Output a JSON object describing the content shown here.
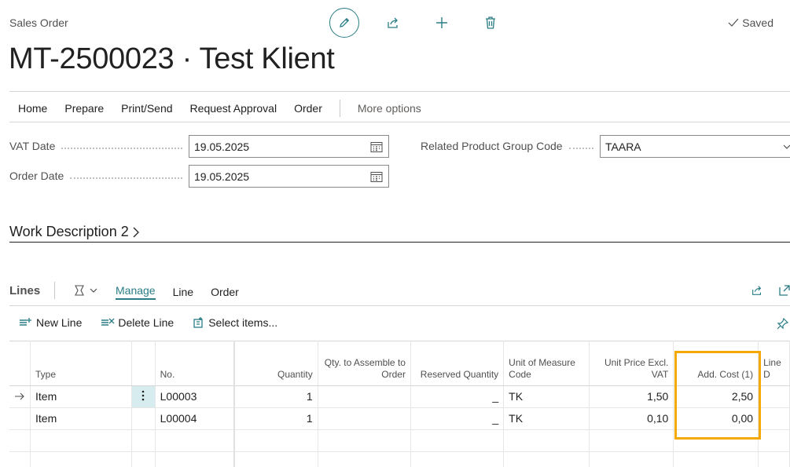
{
  "header": {
    "caption": "Sales Order",
    "title": "MT-2500023 · Test Klient",
    "saved_label": "Saved",
    "icons": [
      "edit-icon",
      "share-icon",
      "add-icon",
      "delete-icon"
    ]
  },
  "menu": {
    "items": [
      "Home",
      "Prepare",
      "Print/Send",
      "Request Approval",
      "Order"
    ],
    "more": "More options"
  },
  "fields": {
    "vat_date": {
      "label": "VAT Date",
      "value": "19.05.2025"
    },
    "order_date": {
      "label": "Order Date",
      "value": "19.05.2025"
    },
    "related_product_group": {
      "label": "Related Product Group Code",
      "value": "TAARA"
    }
  },
  "work_description": {
    "title": "Work Description 2"
  },
  "lines": {
    "title": "Lines",
    "tabs": [
      "Manage",
      "Line",
      "Order"
    ],
    "active_tab": "Manage",
    "actions": {
      "new_line": "New Line",
      "delete_line": "Delete Line",
      "select_items": "Select items..."
    },
    "columns": {
      "type": "Type",
      "no": "No.",
      "quantity": "Quantity",
      "qty_assemble": "Qty. to Assemble to Order",
      "reserved": "Reserved Quantity",
      "uom": "Unit of Measure Code",
      "unit_price": "Unit Price Excl. VAT",
      "add_cost": "Add. Cost (1)",
      "line_d": "Line D"
    },
    "rows": [
      {
        "type": "Item",
        "no": "L00003",
        "quantity": "1",
        "qty_assemble": "",
        "reserved": "_",
        "uom": "TK",
        "unit_price": "1,50",
        "add_cost": "2,50"
      },
      {
        "type": "Item",
        "no": "L00004",
        "quantity": "1",
        "qty_assemble": "",
        "reserved": "_",
        "uom": "TK",
        "unit_price": "0,10",
        "add_cost": "0,00"
      }
    ]
  },
  "colors": {
    "accent": "#2a7d85",
    "highlight": "#f5a800"
  }
}
